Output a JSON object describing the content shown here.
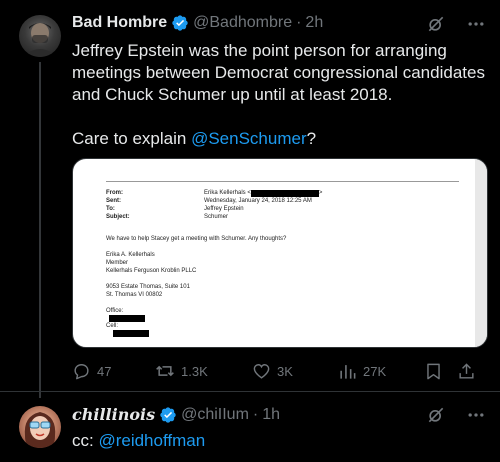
{
  "main_post": {
    "display_name": "Bad Hombre",
    "handle": "@Badhombre",
    "separator": "·",
    "time": "2h",
    "text_line1": "Jeffrey Epstein was the point person for arranging meetings between Democrat congressional candidates and Chuck Schumer up until at least 2018.",
    "text_line2_prefix": "Care to explain ",
    "text_line2_mention": "@SenSchumer",
    "text_line2_suffix": "?",
    "avatar_icon": "avatar-photo",
    "verified_icon": "verified-badge-icon",
    "grok_icon": "grok-slash-icon",
    "more_icon": "more-dots-icon"
  },
  "document": {
    "from_label": "From:",
    "sent_label": "Sent:",
    "to_label": "To:",
    "subject_label": "Subject:",
    "from_value": "Erika Kellerhals <",
    "from_value_end": ">",
    "sent_value": "Wednesday, January 24, 2018 12:25 AM",
    "to_value": "Jeffrey Epstein",
    "subject_value": "Schumer",
    "body": "We have to help Stacey get a meeting with Schumer. Any thoughts?",
    "sig_name": "Erika A. Kellerhals",
    "sig_title": "Member",
    "sig_firm": "Kellerhals Ferguson Kroblin PLLC",
    "sig_addr1": "9053 Estate Thomas, Suite 101",
    "sig_addr2": "St. Thomas VI 00802",
    "office_label": "Office:",
    "cell_label": "Cell:"
  },
  "actions": {
    "replies": "47",
    "reposts": "1.3K",
    "likes": "3K",
    "views": "27K"
  },
  "reply_post": {
    "display_name": "chillinois",
    "handle": "@chiIIum",
    "separator": "·",
    "time": "1h",
    "text_prefix": "cc: ",
    "text_mention": "@reidhoffman"
  },
  "colors": {
    "background": "#000000",
    "text": "#e7e9ea",
    "muted": "#71767b",
    "accent": "#1d9bf0"
  }
}
